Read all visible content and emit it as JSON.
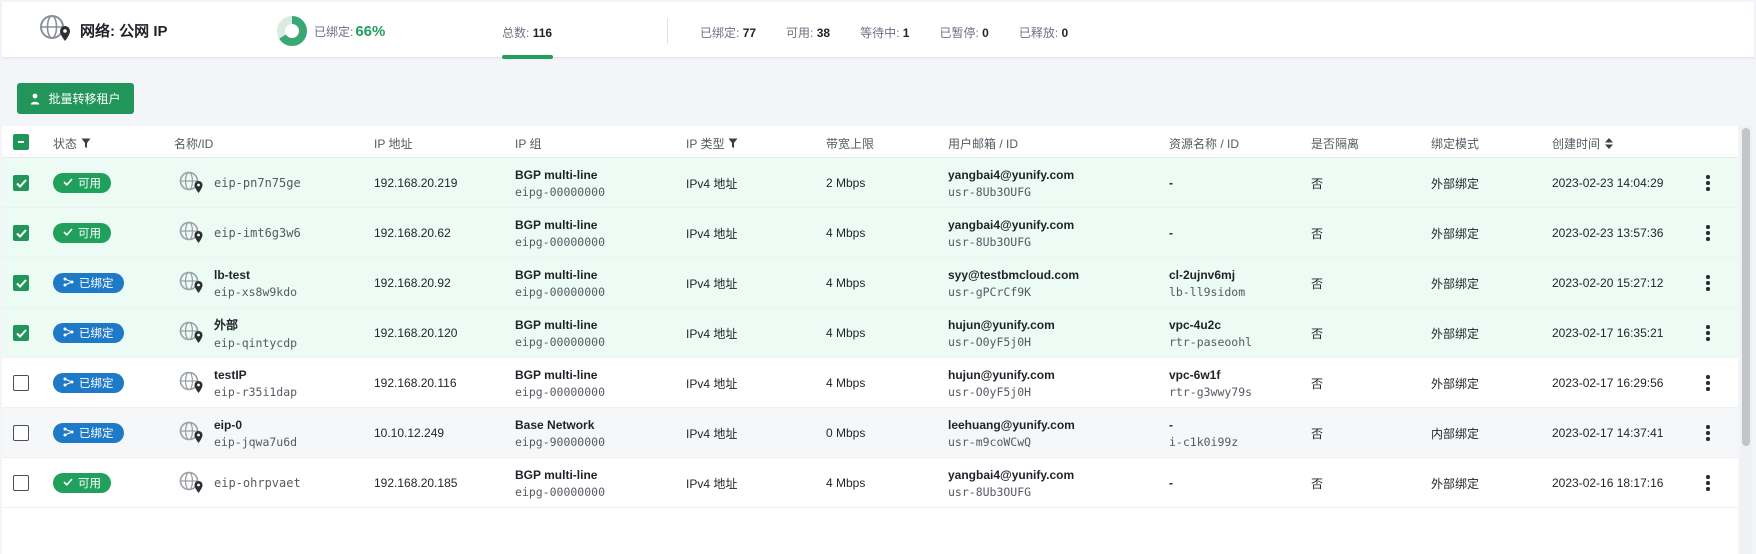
{
  "header": {
    "title": "网络: 公网 IP",
    "bound_label": "已绑定:",
    "bound_percent": "66%",
    "bound_fraction": 0.66,
    "total_label": "总数:",
    "total_value": "116",
    "stats": [
      {
        "label": "已绑定:",
        "value": "77"
      },
      {
        "label": "可用:",
        "value": "38"
      },
      {
        "label": "等待中:",
        "value": "1"
      },
      {
        "label": "已暂停:",
        "value": "0"
      },
      {
        "label": "已释放:",
        "value": "0"
      }
    ]
  },
  "toolbar": {
    "transfer_label": "批量转移租户"
  },
  "table": {
    "columns": {
      "status": "状态",
      "name": "名称/ID",
      "ip": "IP 地址",
      "ipgroup": "IP 组",
      "iptype": "IP 类型",
      "bandwidth": "带宽上限",
      "user": "用户邮箱 / ID",
      "resource": "资源名称 / ID",
      "isolated": "是否隔离",
      "bindmode": "绑定模式",
      "created": "创建时间"
    },
    "rows": [
      {
        "checked": true,
        "status": "可用",
        "status_type": "available",
        "name": "",
        "id": "eip-pn7n75ge",
        "ip": "192.168.20.219",
        "group_name": "BGP multi-line",
        "group_id": "eipg-00000000",
        "type": "IPv4 地址",
        "bandwidth": "2 Mbps",
        "email": "yangbai4@yunify.com",
        "user_id": "usr-8Ub3OUFG",
        "res_name": "-",
        "res_id": "",
        "isolated": "否",
        "bind_mode": "外部绑定",
        "created": "2023-02-23 14:04:29"
      },
      {
        "checked": true,
        "status": "可用",
        "status_type": "available",
        "name": "",
        "id": "eip-imt6g3w6",
        "ip": "192.168.20.62",
        "group_name": "BGP multi-line",
        "group_id": "eipg-00000000",
        "type": "IPv4 地址",
        "bandwidth": "4 Mbps",
        "email": "yangbai4@yunify.com",
        "user_id": "usr-8Ub3OUFG",
        "res_name": "-",
        "res_id": "",
        "isolated": "否",
        "bind_mode": "外部绑定",
        "created": "2023-02-23 13:57:36"
      },
      {
        "checked": true,
        "status": "已绑定",
        "status_type": "bound",
        "name": "lb-test",
        "id": "eip-xs8w9kdo",
        "ip": "192.168.20.92",
        "group_name": "BGP multi-line",
        "group_id": "eipg-00000000",
        "type": "IPv4 地址",
        "bandwidth": "4 Mbps",
        "email": "syy@testbmcloud.com",
        "user_id": "usr-gPCrCf9K",
        "res_name": "cl-2ujnv6mj",
        "res_id": "lb-ll9sidom",
        "isolated": "否",
        "bind_mode": "外部绑定",
        "created": "2023-02-20 15:27:12"
      },
      {
        "checked": true,
        "status": "已绑定",
        "status_type": "bound",
        "name": "外部",
        "id": "eip-qintycdp",
        "ip": "192.168.20.120",
        "group_name": "BGP multi-line",
        "group_id": "eipg-00000000",
        "type": "IPv4 地址",
        "bandwidth": "4 Mbps",
        "email": "hujun@yunify.com",
        "user_id": "usr-O0yF5j0H",
        "res_name": "vpc-4u2c",
        "res_id": "rtr-paseoohl",
        "isolated": "否",
        "bind_mode": "外部绑定",
        "created": "2023-02-17 16:35:21"
      },
      {
        "checked": false,
        "status": "已绑定",
        "status_type": "bound",
        "name": "testIP",
        "id": "eip-r35i1dap",
        "ip": "192.168.20.116",
        "group_name": "BGP multi-line",
        "group_id": "eipg-00000000",
        "type": "IPv4 地址",
        "bandwidth": "4 Mbps",
        "email": "hujun@yunify.com",
        "user_id": "usr-O0yF5j0H",
        "res_name": "vpc-6w1f",
        "res_id": "rtr-g3wwy79s",
        "isolated": "否",
        "bind_mode": "外部绑定",
        "created": "2023-02-17 16:29:56"
      },
      {
        "checked": false,
        "status": "已绑定",
        "status_type": "bound",
        "name": "eip-0",
        "id": "eip-jqwa7u6d",
        "ip": "10.10.12.249",
        "group_name": "Base Network",
        "group_id": "eipg-90000000",
        "type": "IPv4 地址",
        "bandwidth": "0 Mbps",
        "email": "leehuang@yunify.com",
        "user_id": "usr-m9coWCwQ",
        "res_name": "-",
        "res_id": "i-c1k0i99z",
        "isolated": "否",
        "bind_mode": "内部绑定",
        "created": "2023-02-17 14:37:41"
      },
      {
        "checked": false,
        "status": "可用",
        "status_type": "available",
        "name": "",
        "id": "eip-ohrpvaet",
        "ip": "192.168.20.185",
        "group_name": "BGP multi-line",
        "group_id": "eipg-00000000",
        "type": "IPv4 地址",
        "bandwidth": "4 Mbps",
        "email": "yangbai4@yunify.com",
        "user_id": "usr-8Ub3OUFG",
        "res_name": "-",
        "res_id": "",
        "isolated": "否",
        "bind_mode": "外部绑定",
        "created": "2023-02-16 18:17:16"
      }
    ]
  },
  "colors": {
    "accent": "#22965a",
    "bound_blue": "#1e79c7",
    "available_green": "#21a05d"
  }
}
